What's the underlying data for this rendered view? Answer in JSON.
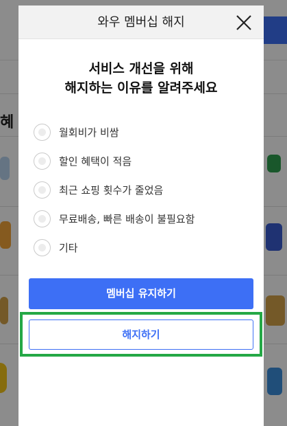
{
  "modal": {
    "title": "와우 멤버십 해지",
    "heading_line1": "서비스 개선을 위해",
    "heading_line2": "해지하는 이유를 알려주세요",
    "reasons": [
      "월회비가 비쌈",
      "할인 혜택이 적음",
      "최근 쇼핑 횟수가 줄었음",
      "무료배송, 빠른 배송이 불필요함",
      "기타"
    ],
    "keep_button": "멤버십 유지하기",
    "cancel_button": "해지하기"
  },
  "colors": {
    "primary": "#3d6ff5",
    "highlight_border": "#24a846"
  }
}
